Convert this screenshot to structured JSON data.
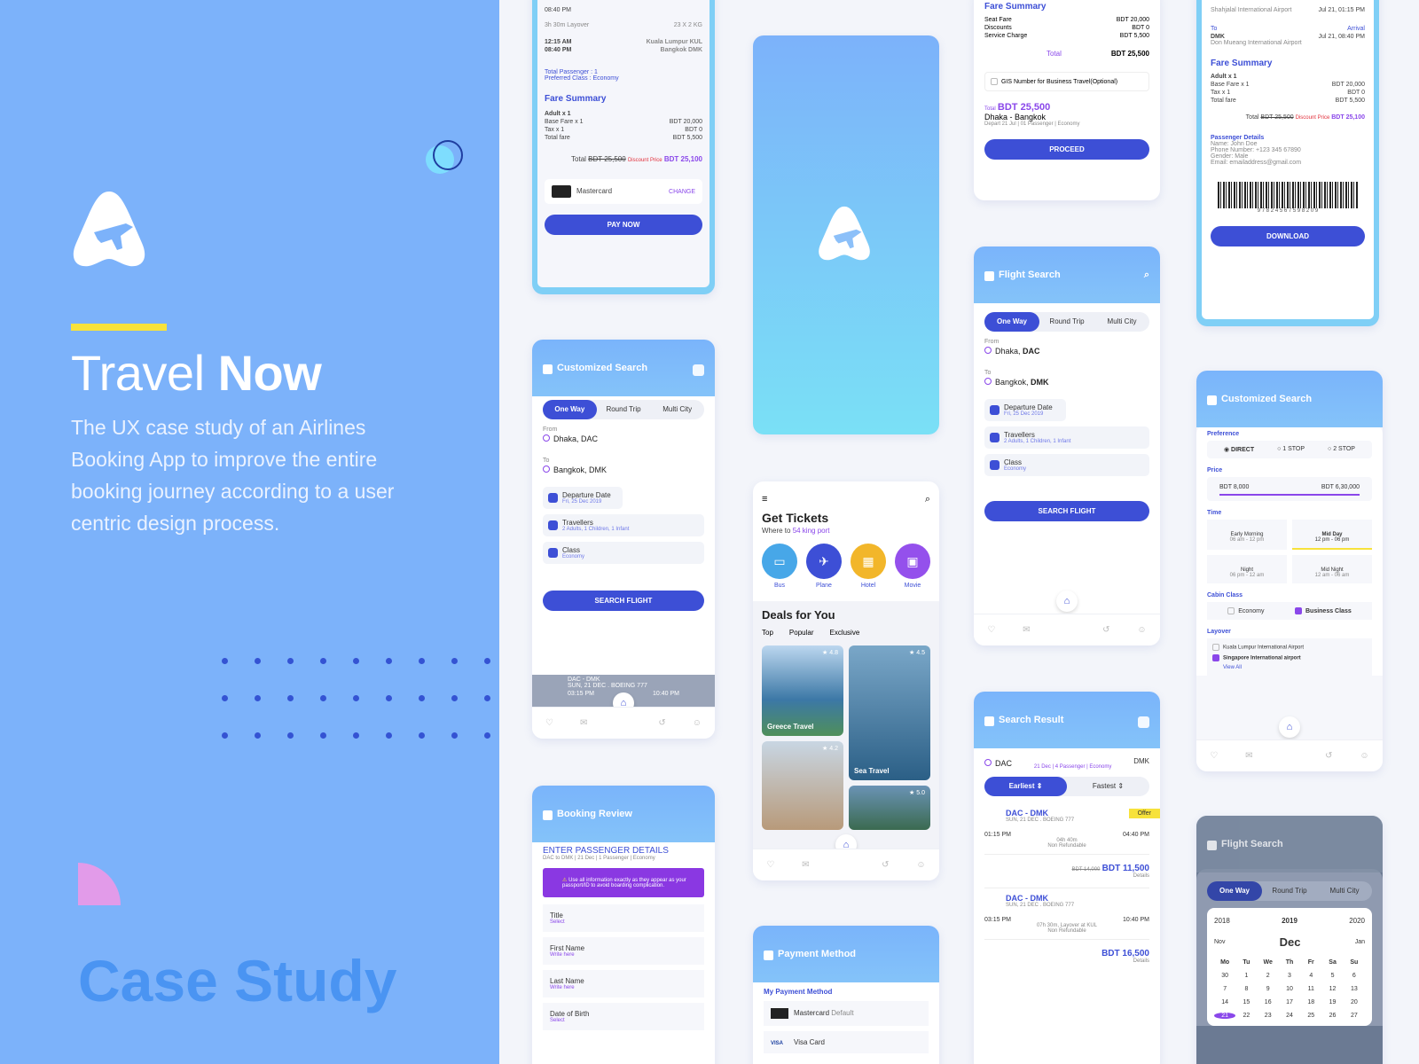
{
  "brand": {
    "title_light": "Travel ",
    "title_bold": "Now",
    "description": "The UX case study of an Airlines Booking App to improve the entire booking journey according to a user centric design process.",
    "case_label": "Case Study"
  },
  "colors": {
    "primary": "#3d4fd6",
    "left_bg": "#7cb2fa",
    "accent_yellow": "#f7e23b",
    "accent_pink": "#e29be9",
    "purple": "#8a47ea"
  },
  "icons": {
    "home": "home-icon",
    "heart": "heart-icon",
    "mail": "mail-icon",
    "history": "history-icon",
    "user": "user-icon",
    "search": "search-icon",
    "filter": "filter-icon",
    "back": "back-icon"
  },
  "pay": {
    "depart_time": "08:40 PM",
    "layover": "3h 30m Layover",
    "baggage": "23 X 2 KG",
    "t1": "12:15 AM",
    "t1_place": "Kuala Lumpur KUL",
    "t2": "08:40 PM",
    "t2_place": "Bangkok DMK",
    "total_passenger": "Total Passenger : 1",
    "preferred_class": "Preferred Class : Economy",
    "fare_summary": "Fare Summary",
    "adult": "Adult x 1",
    "base_fare": "Base Fare x 1",
    "base_val": "BDT 20,000",
    "tax": "Tax x 1",
    "tax_val": "BDT 0",
    "total_fare": "Total fare",
    "total_fare_val": "BDT 5,500",
    "total": "Total",
    "old_price": "BDT 25,500",
    "discount_label": "Discount Price",
    "new_price": "BDT 25,100",
    "card_name": "Mastercard",
    "change": "CHANGE",
    "pay_now": "PAY NOW"
  },
  "custom_search": {
    "title": "Customized Search",
    "tabs": [
      "One Way",
      "Round Trip",
      "Multi City"
    ],
    "from_label": "From",
    "from": "Dhaka, DAC",
    "to_label": "To",
    "to": "Bangkok, DMK",
    "departure": "Departure Date",
    "departure_val": "Fri, 25 Dec 2019",
    "travellers": "Travellers",
    "travellers_val": "2 Adults, 1 Children, 1 Infant",
    "class": "Class",
    "class_val": "Economy",
    "search": "SEARCH FLIGHT",
    "peek_route": "DAC - DMK",
    "peek_date": "SUN, 21 DEC . BOEING 777",
    "peek_t1": "03:15 PM",
    "peek_t2": "10:40 PM"
  },
  "booking": {
    "title": "Booking Review",
    "heading": "ENTER PASSENGER DETAILS",
    "sub": "DAC to DMK | 21 Dec | 1 Passenger | Economy",
    "notice": "Use all information exactly as they appear as your passport/ID to avoid boarding complication.",
    "fields": [
      {
        "label": "Title",
        "value": "Select"
      },
      {
        "label": "First Name",
        "value": "Write here"
      },
      {
        "label": "Last Name",
        "value": "Write here"
      },
      {
        "label": "Date of Birth",
        "value": "Select"
      }
    ]
  },
  "home": {
    "heading": "Get Tickets",
    "where": "Where to ",
    "where_link": "54 king port",
    "categories": [
      "Bus",
      "Plane",
      "Hotel",
      "Movie"
    ],
    "deals": "Deals for You",
    "tabs": [
      "Top",
      "Popular",
      "Exclusive"
    ],
    "photos": [
      {
        "label": "Greece Travel",
        "rating": "4.8"
      },
      {
        "label": "Sea Travel",
        "rating": "4.5"
      },
      {
        "label": "",
        "rating": "4.2"
      },
      {
        "label": "",
        "rating": "5.0"
      }
    ]
  },
  "payment": {
    "title": "Payment Method",
    "section": "My Payment Method",
    "m1": "Mastercard",
    "m1_tag": "Default",
    "m2": "Visa Card",
    "m2_logo": "VISA"
  },
  "summary": {
    "title": "Fare Summary",
    "seat": "Seat Fare",
    "seat_val": "BDT 20,000",
    "disc": "Discounts",
    "disc_val": "BDT 0",
    "service": "Service Charge",
    "service_val": "BDT 5,500",
    "total": "Total",
    "total_val": "BDT 25,500",
    "gis": "GIS Number for Business Travel(Optional)",
    "total_small": "Total",
    "big_price": "BDT 25,500",
    "route": "Dhaka - Bangkok",
    "meta": "Depart 21 Jul | 01 Passenger | Economy",
    "proceed": "PROCEED"
  },
  "flight_search": {
    "title": "Flight Search",
    "tabs": [
      "One Way",
      "Round Trip",
      "Multi City"
    ],
    "from_label": "From",
    "from_city": "Dhaka,",
    "from_code": " DAC",
    "to_label": "To",
    "to_city": "Bangkok,",
    "to_code": " DMK",
    "departure": "Departure Date",
    "departure_val": "Fri, 25 Dec 2019",
    "travellers": "Travellers",
    "travellers_val": "2 Adults, 1 Children, 1 Infant",
    "class": "Class",
    "class_val": "Economy",
    "search": "SEARCH FLIGHT"
  },
  "results": {
    "title": "Search Result",
    "from": "DAC",
    "to": "DMK",
    "meta": "21 Dec | 4 Passenger | Economy",
    "sort": [
      "Earliest ⇕",
      "Fastest ⇕"
    ],
    "items": [
      {
        "route": "DAC - DMK",
        "date": "SUN, 21 DEC . BOEING 777",
        "t1": "01:15 PM",
        "t2": "04:40 PM",
        "dur": "04h 40m",
        "note": "Non Refundable",
        "old": "BDT 14,000",
        "price": "BDT 11,500",
        "offer": "Offer"
      },
      {
        "route": "DAC - DMK",
        "date": "SUN, 21 DEC . BOEING 777",
        "t1": "03:15 PM",
        "t2": "10:40 PM",
        "dur": "07h 30m, Layover at KUL",
        "note": "Non Refundable",
        "old": "",
        "price": "BDT 16,500",
        "offer": ""
      }
    ],
    "details": "Details"
  },
  "ticket": {
    "airport1": "Shahjalal International Airport",
    "date1": "Jul 21, 01:15 PM",
    "to": "To",
    "arrival": "Arrival",
    "dest": "DMK",
    "dest_airport": "Don Mueang International Airport",
    "date2": "Jul 21, 08:40 PM",
    "fare": "Fare Summary",
    "adult": "Adult x 1",
    "base": "Base Fare x 1",
    "base_val": "BDT 20,000",
    "tax": "Tax x 1",
    "tax_val": "BDT 0",
    "tf": "Total fare",
    "tf_val": "BDT 5,500",
    "total": "Total",
    "old": "BDT 25,500",
    "disc": "Discount Price",
    "new": "BDT 25,100",
    "pd": "Passenger Details",
    "name": "Name: John Doe",
    "phone": "Phone Number: +123 345 67890",
    "gender": "Gender: Male",
    "email": "Email: emailaddress@gmail.com",
    "barcode_num": "9 7 8 2 4 5 6 7 5 9 8 2 0 9",
    "download": "DOWNLOAD"
  },
  "filters": {
    "title": "Customized Search",
    "pref": "Preference",
    "pref_opts": [
      "DIRECT",
      "1 STOP",
      "2 STOP"
    ],
    "price": "Price",
    "p_min": "BDT 8,000",
    "p_max": "BDT 6,30,000",
    "time": "Time",
    "slots": [
      {
        "name": "Early Morning",
        "range": "06 am - 12 pm"
      },
      {
        "name": "Mid Day",
        "range": "12 pm - 06 pm"
      },
      {
        "name": "Night",
        "range": "06 pm - 12 am"
      },
      {
        "name": "Mid Night",
        "range": "12 am - 06 am"
      }
    ],
    "cabin": "Cabin Class",
    "cabin_opts": [
      "Economy",
      "Business Class"
    ],
    "layover": "Layover",
    "lay_opts": [
      "Kuala Lumpur International Airport",
      "Singapore International airport"
    ],
    "view_all": "View All"
  },
  "calendar": {
    "title": "Flight Search",
    "tabs": [
      "One Way",
      "Round Trip",
      "Multi City"
    ],
    "years": [
      "2018",
      "2019",
      "2020"
    ],
    "months": [
      "Nov",
      "Dec",
      "Jan"
    ],
    "days": [
      "Mo",
      "Tu",
      "We",
      "Th",
      "Fr",
      "Sa",
      "Su"
    ],
    "dates": [
      "30",
      "1",
      "2",
      "3",
      "4",
      "5",
      "6",
      "7",
      "8",
      "9",
      "10",
      "11",
      "12",
      "13",
      "14",
      "15",
      "16",
      "17",
      "18",
      "19",
      "20",
      "21",
      "22",
      "23",
      "24",
      "25",
      "26",
      "27"
    ]
  }
}
